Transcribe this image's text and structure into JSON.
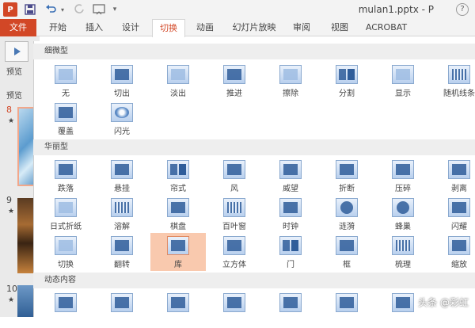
{
  "app": {
    "logo": "P",
    "title": "mulan1.pptx - P",
    "help": "?"
  },
  "quick_access": {
    "save_icon": "save-icon",
    "undo_icon": "undo-icon",
    "redo_icon": "redo-icon"
  },
  "tabs": [
    "文件",
    "开始",
    "插入",
    "设计",
    "切换",
    "动画",
    "幻灯片放映",
    "审阅",
    "视图",
    "ACROBAT"
  ],
  "left": {
    "preview_label": "预览",
    "preview_group_label": "预览",
    "slides": [
      "8",
      "9",
      "10"
    ],
    "star": "★"
  },
  "sections": {
    "subtle": {
      "title": "细微型",
      "items": [
        "无",
        "切出",
        "淡出",
        "推进",
        "擦除",
        "分割",
        "显示",
        "随机线条",
        "覆盖",
        "闪光"
      ]
    },
    "exciting": {
      "title": "华丽型",
      "items": [
        "跌落",
        "悬挂",
        "帘式",
        "风",
        "威望",
        "折断",
        "压碎",
        "剥离",
        "日式折纸",
        "溶解",
        "棋盘",
        "百叶窗",
        "时钟",
        "涟漪",
        "蜂巢",
        "闪耀",
        "切换",
        "翻转",
        "库",
        "立方体",
        "门",
        "框",
        "梳理",
        "缩放"
      ]
    },
    "dynamic": {
      "title": "动态内容"
    }
  },
  "selected_transition": "库",
  "watermark": "头条 @彩虹"
}
